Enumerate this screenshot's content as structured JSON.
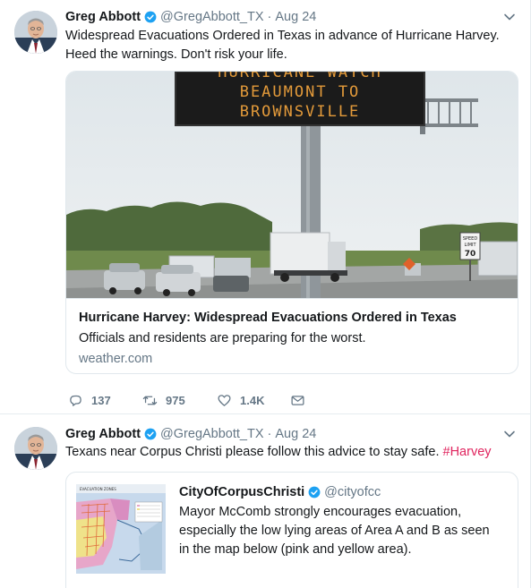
{
  "tweets": [
    {
      "author_name": "Greg Abbott",
      "handle": "@GregAbbott_TX",
      "separator": "·",
      "date": "Aug 24",
      "text": "Widespread Evacuations Ordered in Texas in advance of Hurricane Harvey. Heed the warnings. Don't risk your life.",
      "card": {
        "sign_lines": [
          "HURRICANE WATCH",
          "BEAUMONT TO",
          "BROWNSVILLE"
        ],
        "speed_sign_top": "SPEED",
        "speed_sign_mid": "LIMIT",
        "speed_sign_value": "70",
        "title": "Hurricane Harvey: Widespread Evacuations Ordered in Texas",
        "description": "Officials and residents are preparing for the worst.",
        "domain": "weather.com"
      },
      "actions": {
        "reply_count": "137",
        "retweet_count": "975",
        "like_count": "1.4K"
      }
    },
    {
      "author_name": "Greg Abbott",
      "handle": "@GregAbbott_TX",
      "separator": "·",
      "date": "Aug 24",
      "text": "Texans near Corpus Christi please follow this advice to stay safe.",
      "hashtag": "#Harvey",
      "quote": {
        "map_title": "EVACUATION ZONES",
        "author_name": "CityOfCorpusChristi",
        "handle": "@cityofcc",
        "text": "Mayor McComb strongly encourages evacuation, especially the low lying areas of Area A and B as seen in the map below (pink and yellow area)."
      }
    }
  ],
  "icons": {
    "verified": "verified-badge-icon",
    "caret": "chevron-down-icon",
    "reply": "reply-icon",
    "retweet": "retweet-icon",
    "like": "heart-icon",
    "dm": "envelope-icon"
  },
  "colors": {
    "verified": "#1da1f2",
    "secondary_text": "#657786",
    "hashtag": "#e0245e",
    "border": "#e1e8ed"
  }
}
